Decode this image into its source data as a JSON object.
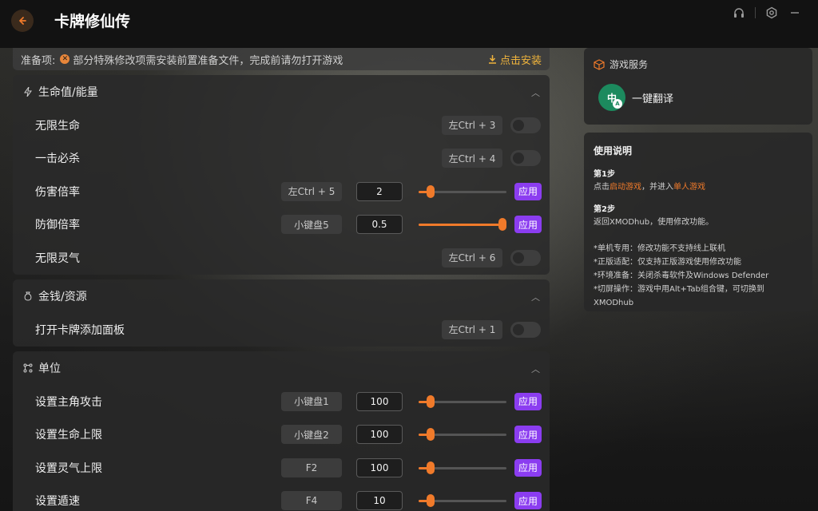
{
  "app": {
    "title": "卡牌修仙传"
  },
  "titlebar": {
    "icons": [
      "back-arrow-icon",
      "headset-icon",
      "settings-icon",
      "minimize-icon"
    ]
  },
  "notice": {
    "label": "准备项:",
    "message": "部分特殊修改项需安装前置准备文件，完成前请勿打开游戏",
    "install_label": "点击安装"
  },
  "sections": [
    {
      "title": "生命值/能量",
      "rows": [
        {
          "label": "无限生命",
          "hotkey": "左Ctrl + 3",
          "type": "toggle"
        },
        {
          "label": "一击必杀",
          "hotkey": "左Ctrl + 4",
          "type": "toggle"
        },
        {
          "label": "伤害倍率",
          "hotkey": "左Ctrl + 5",
          "type": "slider",
          "value": "2",
          "apply": "应用"
        },
        {
          "label": "防御倍率",
          "hotkey": "小键盘5",
          "type": "slider",
          "value": "0.5",
          "apply": "应用"
        },
        {
          "label": "无限灵气",
          "hotkey": "左Ctrl + 6",
          "type": "toggle"
        }
      ]
    },
    {
      "title": "金钱/资源",
      "rows": [
        {
          "label": "打开卡牌添加面板",
          "hotkey": "左Ctrl + 1",
          "type": "toggle"
        }
      ]
    },
    {
      "title": "单位",
      "rows": [
        {
          "label": "设置主角攻击",
          "hotkey": "小键盘1",
          "type": "slider",
          "value": "100",
          "apply": "应用"
        },
        {
          "label": "设置生命上限",
          "hotkey": "小键盘2",
          "type": "slider",
          "value": "100",
          "apply": "应用"
        },
        {
          "label": "设置灵气上限",
          "hotkey": "F2",
          "type": "slider",
          "value": "100",
          "apply": "应用"
        },
        {
          "label": "设置遁速",
          "hotkey": "F4",
          "type": "slider",
          "value": "10",
          "apply": "应用"
        }
      ]
    }
  ],
  "slider_levels": {
    "damage": 0.1,
    "defense": 1.0,
    "attack": 0.1,
    "hp": 0.1,
    "qi": 0.1,
    "speed": 0.1
  },
  "services": {
    "title": "游戏服务",
    "items": [
      {
        "label": "一键翻译",
        "icon_main": "中",
        "icon_sub": "A"
      }
    ]
  },
  "help": {
    "title": "使用说明",
    "step1_title": "第1步",
    "step1_pre": "点击",
    "step1_link1": "启动游戏",
    "step1_mid": "，并进入",
    "step1_link2": "单人游戏",
    "step2_title": "第2步",
    "step2_text": "返回XMODhub，使用修改功能。",
    "notes": [
      "*单机专用：修改功能不支持线上联机",
      "*正版适配：仅支持正版游戏使用修改功能",
      "*环境准备：关闭杀毒软件及Windows Defender",
      "*切屏操作：游戏中用Alt+Tab组合键，可切换到XMODhub"
    ]
  },
  "colors": {
    "accent": "#f07a2a",
    "apply_button": "#8b3df0",
    "warning": "#f0b43c"
  }
}
